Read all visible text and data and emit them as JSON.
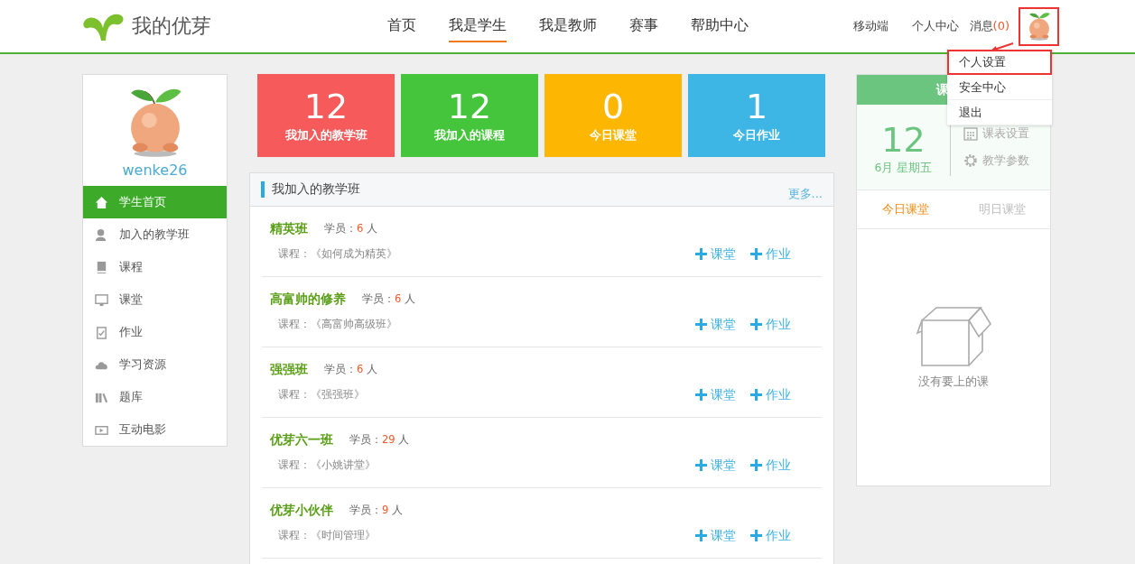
{
  "header": {
    "logo_text": "我的优芽",
    "nav": [
      {
        "label": "首页",
        "selected": false
      },
      {
        "label": "我是学生",
        "selected": true
      },
      {
        "label": "我是教师",
        "selected": false
      },
      {
        "label": "赛事",
        "selected": false
      },
      {
        "label": "帮助中心",
        "selected": false
      }
    ],
    "links": [
      "移动端",
      "个人中心"
    ],
    "messages": {
      "label": "消息",
      "count": "(0)"
    }
  },
  "user_menu": {
    "items": [
      {
        "label": "个人设置",
        "selected": true
      },
      {
        "label": "安全中心",
        "selected": false
      },
      {
        "label": "退出",
        "selected": false
      }
    ]
  },
  "sidebar": {
    "username": "wenke26",
    "items": [
      {
        "label": "学生首页",
        "selected": true
      },
      {
        "label": "加入的教学班",
        "selected": false
      },
      {
        "label": "课程",
        "selected": false
      },
      {
        "label": "课堂",
        "selected": false
      },
      {
        "label": "作业",
        "selected": false
      },
      {
        "label": "学习资源",
        "selected": false
      },
      {
        "label": "题库",
        "selected": false
      },
      {
        "label": "互动电影",
        "selected": false
      }
    ]
  },
  "stats": [
    {
      "value": "12",
      "label": "我加入的教学班",
      "color": "#f65a5a"
    },
    {
      "value": "12",
      "label": "我加入的课程",
      "color": "#45c53b"
    },
    {
      "value": "0",
      "label": "今日课堂",
      "color": "#fdb702"
    },
    {
      "value": "1",
      "label": "今日作业",
      "color": "#3db6e6"
    }
  ],
  "classes_panel": {
    "title": "我加入的教学班",
    "more": "更多...",
    "rows": [
      {
        "name": "精英班",
        "members_label": "学员：",
        "count": "6",
        "unit": "人",
        "course": "课程：《如何成为精英》",
        "actions": [
          "课堂",
          "作业"
        ]
      },
      {
        "name": "高富帅的修养",
        "members_label": "学员：",
        "count": "6",
        "unit": "人",
        "course": "课程：《高富帅高级班》",
        "actions": [
          "课堂",
          "作业"
        ]
      },
      {
        "name": "强强班",
        "members_label": "学员：",
        "count": "6",
        "unit": "人",
        "course": "课程：《强强班》",
        "actions": [
          "课堂",
          "作业"
        ]
      },
      {
        "name": "优芽六一班",
        "members_label": "学员：",
        "count": "29",
        "unit": "人",
        "course": "课程：《小姚讲堂》",
        "actions": [
          "课堂",
          "作业"
        ]
      },
      {
        "name": "优芽小伙伴",
        "members_label": "学员：",
        "count": "9",
        "unit": "人",
        "course": "课程：《时间管理》",
        "actions": [
          "课堂",
          "作业"
        ]
      }
    ]
  },
  "schedule": {
    "title": "课",
    "day": "12",
    "date": "6月 星期五",
    "links": [
      "课表设置",
      "教学参数"
    ],
    "tabs": [
      {
        "label": "今日课堂",
        "selected": true
      },
      {
        "label": "明日课堂",
        "selected": false
      }
    ],
    "empty_text": "没有要上的课"
  }
}
